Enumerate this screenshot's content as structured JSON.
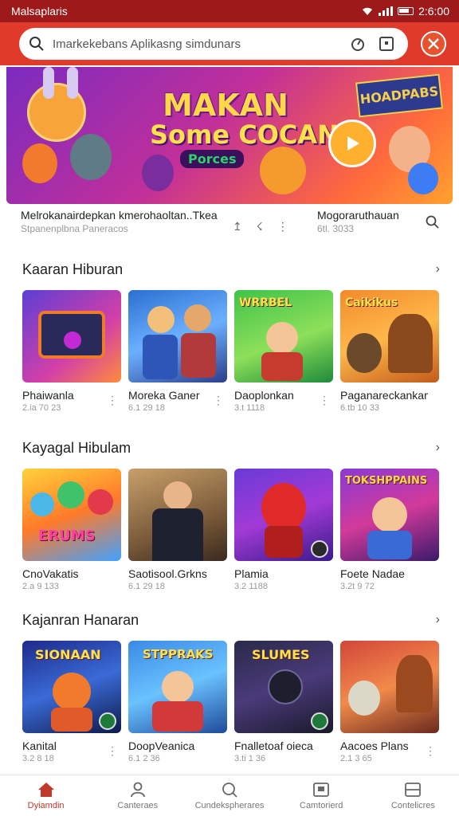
{
  "status_bar": {
    "app_name": "Malsaplaris",
    "time": "2:6:00"
  },
  "search": {
    "placeholder": "Imarkekebans Aplikasng simdunars"
  },
  "hero": {
    "title_line1": "MAKAN",
    "title_line2": "Some COCAN!",
    "title_line3": "Porces",
    "ribbon_text": "HOADPABS",
    "left_name": "Melrokanairdepkan kmerohaoltan..Tkea",
    "left_meta": "Stpanenplbna Paneracos",
    "right_name": "Mogoraruthauan",
    "right_meta": "6tl. 3033"
  },
  "sections": [
    {
      "title": "Kaaran Hiburan",
      "items": [
        {
          "name": "Phaiwanla",
          "meta": "2.ia 70 23",
          "thumb_text": ""
        },
        {
          "name": "Moreka Ganer",
          "meta": "6.1 29 18",
          "thumb_text": ""
        },
        {
          "name": "Daoplonkan",
          "meta": "3.t 1118",
          "thumb_text": "WRRBEL"
        },
        {
          "name": "Paganareckankam",
          "meta": "6.tb 10 33",
          "thumb_text": "Caikikus"
        }
      ]
    },
    {
      "title": "Kayagal Hibulam",
      "items": [
        {
          "name": "CnoVakatis",
          "meta": "2.a 9 133",
          "thumb_text": "ERUMS"
        },
        {
          "name": "Saotisool.Grkns",
          "meta": "6.1 29 18",
          "thumb_text": ""
        },
        {
          "name": "Plamia",
          "meta": "3.2 1188",
          "thumb_text": ""
        },
        {
          "name": "Foete Nadae",
          "meta": "3.2t 9 72",
          "thumb_text": "TOKSHPPAINS"
        }
      ]
    },
    {
      "title": "Kajanran Hanaran",
      "items": [
        {
          "name": "Kanital",
          "meta": "3.2 8 18",
          "thumb_text": "SIONAAN"
        },
        {
          "name": "DoopVeanica",
          "meta": "6.1 2 36",
          "thumb_text": "STPPRAKS"
        },
        {
          "name": "Fnalletoaf oieca",
          "meta": "3.ti 1 36",
          "thumb_text": "SLUMES"
        },
        {
          "name": "Aacoes Plans",
          "meta": "2.1 3 65",
          "thumb_text": ""
        }
      ]
    }
  ],
  "bottom_nav": [
    {
      "label": "Dyiamdin",
      "icon": "home-icon",
      "active": true
    },
    {
      "label": "Canteraes",
      "icon": "person-icon",
      "active": false
    },
    {
      "label": "Cundekspherares",
      "icon": "search-icon",
      "active": false
    },
    {
      "label": "Camtorierd",
      "icon": "picture-icon",
      "active": false
    },
    {
      "label": "Contelicres",
      "icon": "window-icon",
      "active": false
    }
  ],
  "colors": {
    "status_bar": "#9e1a1a",
    "app_bar": "#e03a2a",
    "active": "#c0392b"
  }
}
